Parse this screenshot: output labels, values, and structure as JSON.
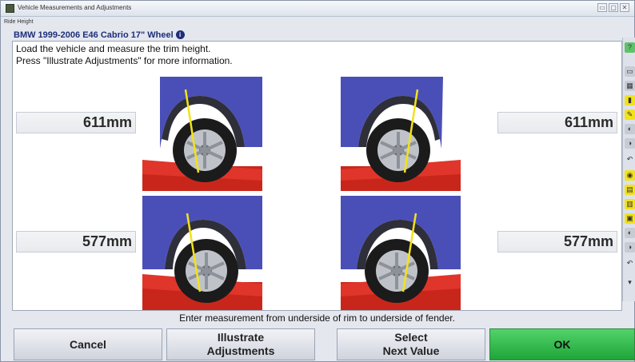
{
  "window": {
    "title": "Vehicle Measurements and Adjustments",
    "subtitle": "Ride Height",
    "controls": [
      "▭",
      "▢",
      "✕"
    ]
  },
  "vehicle": {
    "name": "BMW 1999-2006 E46 Cabrio 17\" Wheel",
    "badge": "i"
  },
  "instructions": {
    "line1": "Load the vehicle and measure the trim height.",
    "line2": "Press \"Illustrate Adjustments\" for more information."
  },
  "measurements": {
    "front_left": "611mm",
    "front_right": "611mm",
    "rear_left": "577mm",
    "rear_right": "577mm"
  },
  "footer_hint": "Enter measurement from underside of rim to underside of fender.",
  "buttons": {
    "cancel": "Cancel",
    "illustrate": "Illustrate\nAdjustments",
    "select_next": "Select\nNext Value",
    "ok": "OK"
  },
  "colors": {
    "car_body": "#4a4fb8",
    "lift_red": "#d2291e",
    "measure_line": "#f2e21a",
    "ok_green": "#2fbf4a",
    "vehicle_title": "#1e2f78"
  },
  "toolbar_icons": [
    "help-icon",
    "vehicle-icon",
    "calendar-icon",
    "measure-icon",
    "tools-icon",
    "camber-icon",
    "toe-icon",
    "undo-icon",
    "gauge-icon",
    "adjust-icon",
    "alignment-icon",
    "car-icon",
    "camber-icon",
    "toe-icon",
    "undo-icon",
    "scroll-down-icon"
  ]
}
